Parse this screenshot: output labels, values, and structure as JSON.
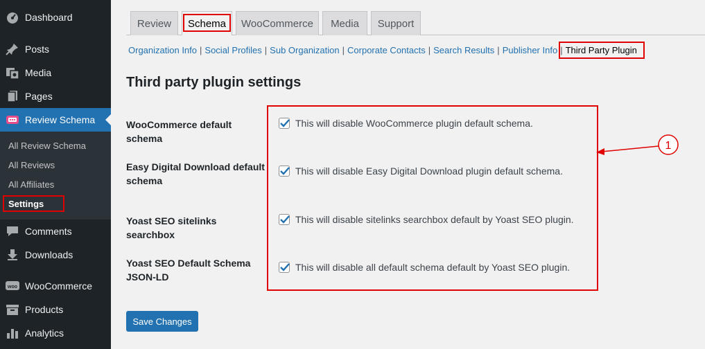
{
  "sidebar": {
    "items": [
      {
        "label": "Dashboard",
        "icon": "dashboard-icon"
      },
      {
        "label": "Posts",
        "icon": "pin-icon"
      },
      {
        "label": "Media",
        "icon": "media-icon"
      },
      {
        "label": "Pages",
        "icon": "pages-icon"
      },
      {
        "label": "Review Schema",
        "icon": "review-schema-icon"
      },
      {
        "label": "Comments",
        "icon": "comment-icon"
      },
      {
        "label": "Downloads",
        "icon": "download-icon"
      },
      {
        "label": "WooCommerce",
        "icon": "woo-icon"
      },
      {
        "label": "Products",
        "icon": "archive-icon"
      },
      {
        "label": "Analytics",
        "icon": "bar-chart-icon"
      }
    ],
    "submenu": [
      "All Review Schema",
      "All Reviews",
      "All Affiliates",
      "Settings"
    ],
    "active_color": "#2271b1"
  },
  "tabs": [
    "Review",
    "Schema",
    "WooCommerce",
    "Media",
    "Support"
  ],
  "active_tab": "Schema",
  "subnav": {
    "links": [
      "Organization Info",
      "Social Profiles",
      "Sub Organization",
      "Corporate Contacts",
      "Search Results",
      "Publisher Info"
    ],
    "current": "Third Party Plugin",
    "separator": "|"
  },
  "page_title": "Third party plugin settings",
  "settings": [
    {
      "label_line1": "WooCommerce default schema",
      "label_line2": "",
      "desc": "This will disable WooCommerce plugin default schema.",
      "checked": true
    },
    {
      "label_line1": "Easy Digital Download default",
      "label_line2": "schema",
      "desc": "This will disable Easy Digital Download plugin default schema.",
      "checked": true
    },
    {
      "label_line1": "Yoast SEO sitelinks searchbox",
      "label_line2": "",
      "desc": "This will disable sitelinks searchbox default by Yoast SEO plugin.",
      "checked": true
    },
    {
      "label_line1": "Yoast SEO Default Schema",
      "label_line2": "JSON-LD",
      "desc": "This will disable all default schema default by Yoast SEO plugin.",
      "checked": true
    }
  ],
  "save_label": "Save Changes",
  "annotation": {
    "number": "1",
    "color": "#e00000"
  }
}
